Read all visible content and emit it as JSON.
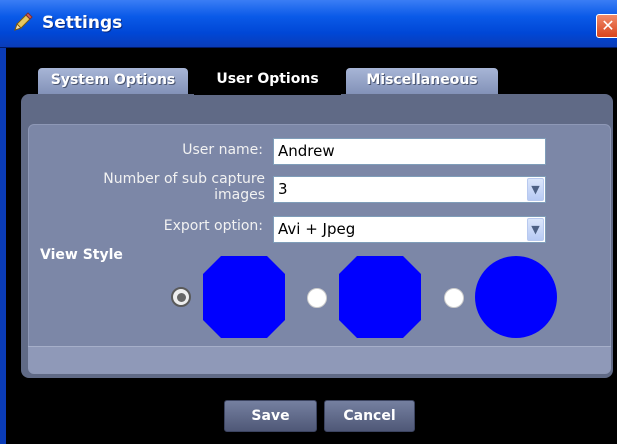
{
  "window": {
    "title": "Settings",
    "close_glyph": "✕",
    "title_icon": "pencil-icon"
  },
  "tabs": [
    {
      "label": "System Options",
      "active": false
    },
    {
      "label": "User Options",
      "active": true
    },
    {
      "label": "Miscellaneous",
      "active": false
    }
  ],
  "form": {
    "user_name_label": "User name:",
    "user_name_value": "Andrew",
    "sub_capture_label_line1": "Number of sub capture",
    "sub_capture_label_line2": "images",
    "sub_capture_value": "3",
    "export_label": "Export option:",
    "export_value": "Avi + Jpeg",
    "dropdown_glyph": "▼"
  },
  "view_style": {
    "label": "View Style",
    "options": [
      {
        "shape": "octagon",
        "selected": true
      },
      {
        "shape": "octagon",
        "selected": false
      },
      {
        "shape": "circle",
        "selected": false
      }
    ],
    "shape_color": "#0000ff"
  },
  "buttons": {
    "save": "Save",
    "cancel": "Cancel"
  }
}
